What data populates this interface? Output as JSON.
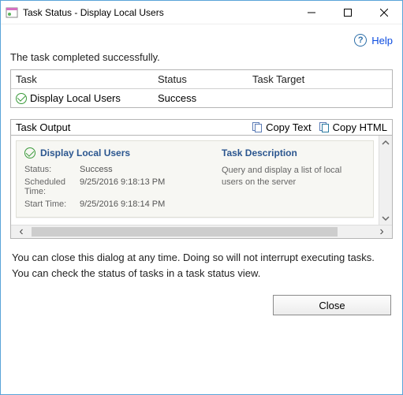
{
  "titlebar": {
    "title": "Task Status - Display Local Users"
  },
  "help": {
    "label": "Help"
  },
  "message": "The task completed successfully.",
  "grid": {
    "headers": {
      "task": "Task",
      "status": "Status",
      "target": "Task Target"
    },
    "row": {
      "task": "Display Local Users",
      "status": "Success",
      "target": ""
    }
  },
  "output": {
    "title": "Task Output",
    "copy_text": "Copy Text",
    "copy_html": "Copy HTML",
    "card": {
      "title": "Display Local Users",
      "status_label": "Status:",
      "status_value": "Success",
      "scheduled_label": "Scheduled Time:",
      "scheduled_value": "9/25/2016 9:18:13 PM",
      "start_label": "Start Time:",
      "start_value": "9/25/2016 9:18:14 PM",
      "desc_head": "Task Description",
      "desc_body": "Query and display a list of local users on the server"
    }
  },
  "note": "You can close this dialog at any time. Doing so will not interrupt executing tasks. You can check the status of tasks in a task status view.",
  "close": "Close"
}
